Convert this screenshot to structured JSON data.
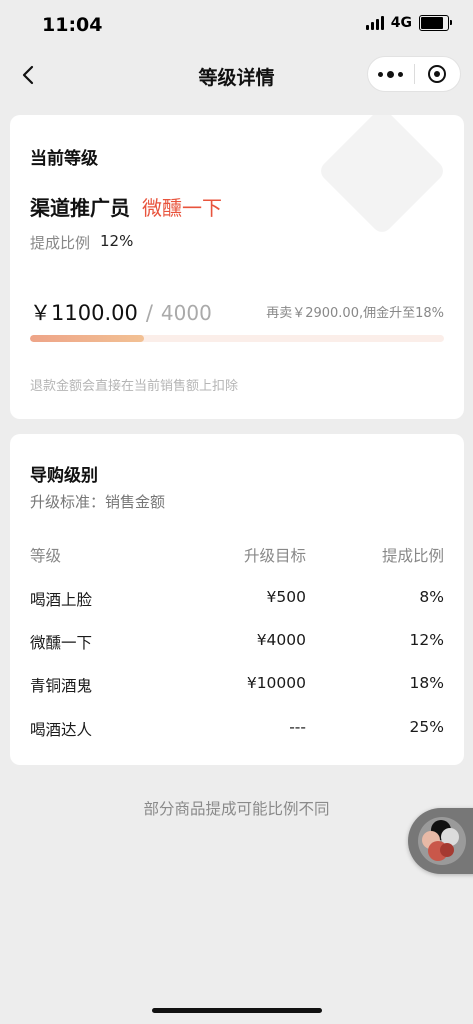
{
  "status_bar": {
    "time": "11:04",
    "network": "4G"
  },
  "nav": {
    "title": "等级详情"
  },
  "current_level": {
    "section_title": "当前等级",
    "name": "渠道推广员",
    "tag": "微醺一下",
    "rate_label": "提成比例",
    "rate_value": "12%",
    "sales_current": "￥1100.00",
    "sales_separator": "/",
    "sales_target": "4000",
    "upgrade_hint": "再卖￥2900.00,佣金升至18%",
    "progress_fraction": 0.275,
    "refund_note": "退款金额会直接在当前销售额上扣除"
  },
  "guide_levels": {
    "section_title": "导购级别",
    "criteria": "升级标准：销售金额",
    "columns": [
      "等级",
      "升级目标",
      "提成比例"
    ],
    "rows": [
      [
        "喝酒上脸",
        "¥500",
        "8%"
      ],
      [
        "微醺一下",
        "¥4000",
        "12%"
      ],
      [
        "青铜酒鬼",
        "¥10000",
        "18%"
      ],
      [
        "喝酒达人",
        "---",
        "25%"
      ]
    ]
  },
  "footer_note": "部分商品提成可能比例不同",
  "colors": {
    "accent": "#e8543d",
    "progress_start": "#eea488",
    "progress_end": "#f2c194",
    "background": "#ededed"
  }
}
